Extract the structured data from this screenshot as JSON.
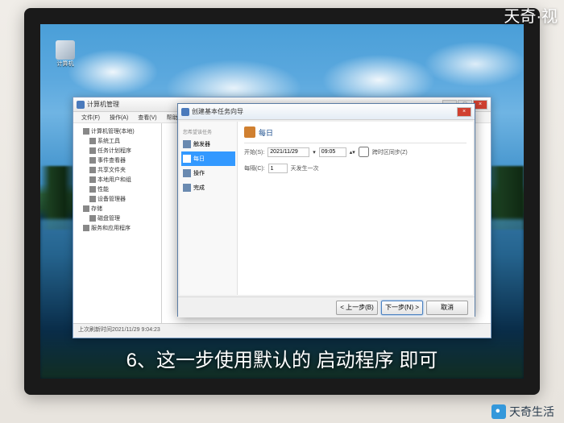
{
  "watermark": {
    "top": "天奇·视",
    "bottom": "天奇生活"
  },
  "caption": "6、这一步使用默认的 启动程序 即可",
  "desktop": {
    "icon_label": "计算机"
  },
  "main_window": {
    "title": "计算机管理",
    "menu": [
      "文件(F)",
      "操作(A)",
      "查看(V)",
      "帮助(H)"
    ],
    "tree": [
      {
        "label": "计算机管理(本地)",
        "level": 1
      },
      {
        "label": "系统工具",
        "level": 2
      },
      {
        "label": "任务计划程序",
        "level": 2
      },
      {
        "label": "事件查看器",
        "level": 2
      },
      {
        "label": "共享文件夹",
        "level": 2
      },
      {
        "label": "本地用户和组",
        "level": 2
      },
      {
        "label": "性能",
        "level": 2
      },
      {
        "label": "设备管理器",
        "level": 2
      },
      {
        "label": "存储",
        "level": 1
      },
      {
        "label": "磁盘管理",
        "level": 2
      },
      {
        "label": "服务和应用程序",
        "level": 1
      }
    ],
    "status": "上次刷新时间2021/11/29 9:04:23"
  },
  "dialog": {
    "title": "创建基本任务向导",
    "section_title": "每日",
    "left_panel": {
      "header": "您希望该任务",
      "items": [
        {
          "label": "触发器",
          "selected": false
        },
        {
          "label": "每日",
          "selected": true
        },
        {
          "label": "操作",
          "selected": false
        },
        {
          "label": "完成",
          "selected": false
        }
      ]
    },
    "form": {
      "start_label": "开始(S):",
      "start_date": "2021/11/29",
      "start_time": "09:05",
      "sync_checkbox": "跨时区同步(Z)",
      "recur_label": "每隔(C):",
      "recur_value": "1",
      "recur_unit": "天发生一次"
    },
    "buttons": {
      "back": "< 上一步(B)",
      "next": "下一步(N) >",
      "cancel": "取消"
    }
  }
}
